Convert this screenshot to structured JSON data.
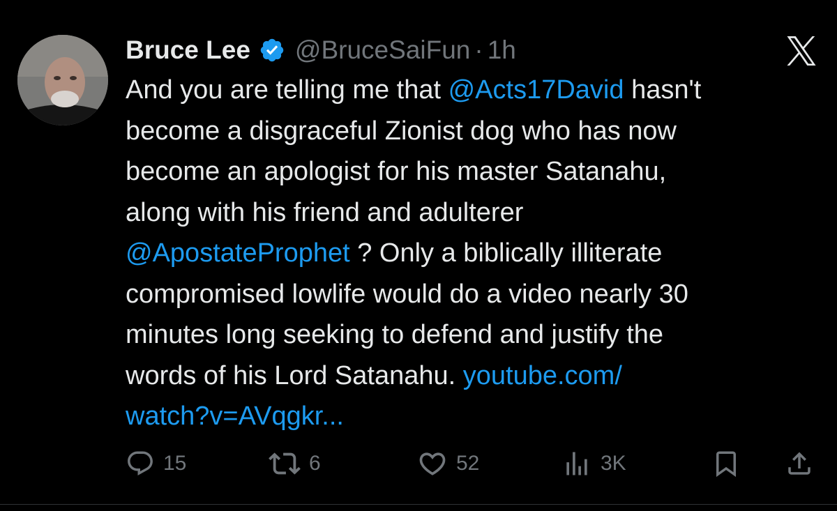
{
  "tweet": {
    "author": {
      "name": "Bruce Lee",
      "handle": "@BruceSaiFun",
      "separator": "·",
      "time": "1h",
      "verified": true
    },
    "text_lines": [
      [
        {
          "t": "And you are telling me that "
        },
        {
          "t": "@Acts17David",
          "link": true
        },
        {
          "t": "  hasn't"
        }
      ],
      [
        {
          "t": "become a disgraceful Zionist dog who has now"
        }
      ],
      [
        {
          "t": "become an apologist for his master Satanahu,"
        }
      ],
      [
        {
          "t": "along with his friend and adulterer"
        }
      ],
      [
        {
          "t": "@ApostateProphet",
          "link": true
        },
        {
          "t": " ? Only a biblically illiterate"
        }
      ],
      [
        {
          "t": "compromised lowlife would do a video nearly 30"
        }
      ],
      [
        {
          "t": "minutes long seeking to defend and justify the"
        }
      ],
      [
        {
          "t": "words of his Lord Satanahu. "
        },
        {
          "t": "youtube.com/",
          "link": true
        }
      ],
      [
        {
          "t": "watch?v=AVqgkr...",
          "link": true
        }
      ]
    ],
    "actions": {
      "replies": "15",
      "retweets": "6",
      "likes": "52",
      "views": "3K"
    }
  },
  "icons": {
    "avatar": "avatar",
    "verified": "verified-badge-icon",
    "close": "x-logo-icon",
    "reply": "reply-icon",
    "retweet": "retweet-icon",
    "like": "heart-icon",
    "views": "views-icon",
    "bookmark": "bookmark-icon",
    "share": "share-icon"
  },
  "colors": {
    "background": "#000000",
    "text": "#e7e9ea",
    "muted": "#71767b",
    "link": "#1d9bf0",
    "verified": "#1d9bf0"
  }
}
